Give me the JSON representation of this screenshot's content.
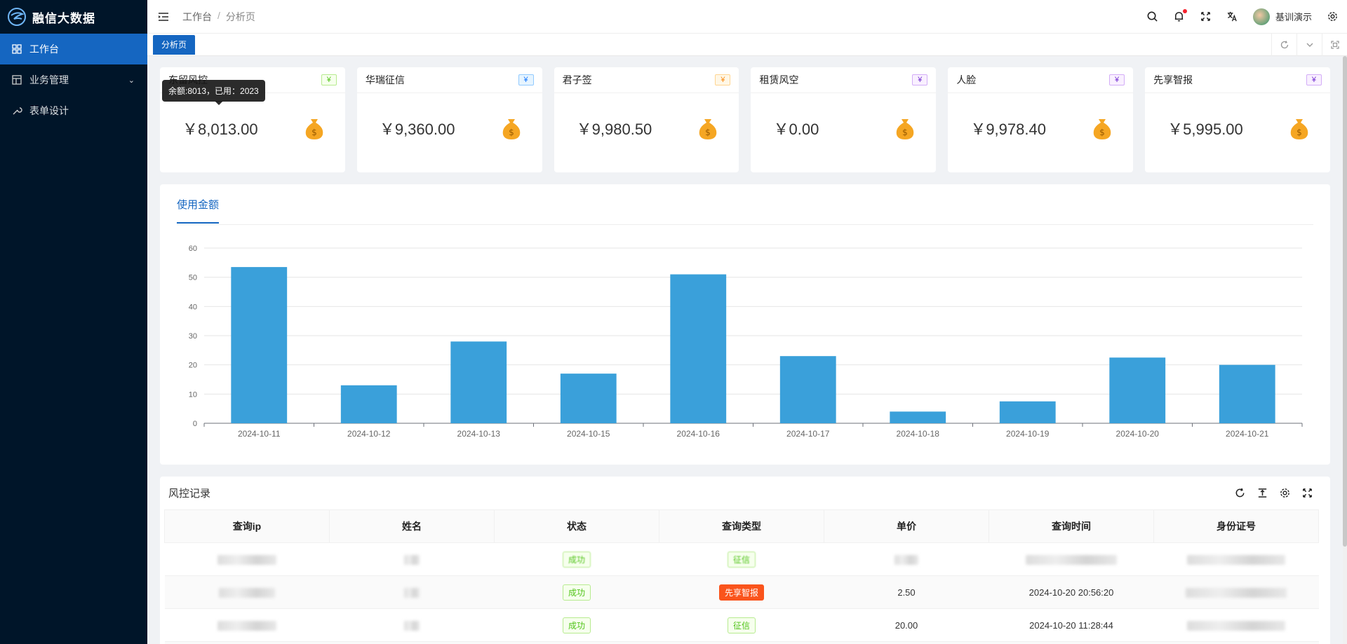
{
  "app": {
    "title": "融信大数据"
  },
  "sidebar": {
    "items": [
      {
        "label": "工作台",
        "icon": "dashboard-icon",
        "active": true
      },
      {
        "label": "业务管理",
        "icon": "table-icon",
        "active": false
      },
      {
        "label": "表单设计",
        "icon": "wrench-icon",
        "active": false
      }
    ]
  },
  "header": {
    "breadcrumb": [
      "工作台",
      "分析页"
    ],
    "user_name": "基训演示"
  },
  "tabs": [
    {
      "label": "分析页"
    }
  ],
  "cards": [
    {
      "title": "东留风控",
      "tag": "¥",
      "tag_color": "green",
      "value": "￥8,013.00"
    },
    {
      "title": "华瑞征信",
      "tag": "¥",
      "tag_color": "blue",
      "value": "￥9,360.00"
    },
    {
      "title": "君子签",
      "tag": "¥",
      "tag_color": "orange",
      "value": "￥9,980.50"
    },
    {
      "title": "租赁风空",
      "tag": "¥",
      "tag_color": "purple",
      "value": "￥0.00"
    },
    {
      "title": "人脸",
      "tag": "¥",
      "tag_color": "purple",
      "value": "￥9,978.40"
    },
    {
      "title": "先享智报",
      "tag": "¥",
      "tag_color": "purple",
      "value": "￥5,995.00"
    }
  ],
  "tooltip": {
    "text": "余额:8013，已用：2023"
  },
  "chart_tab": "使用金额",
  "chart_data": {
    "type": "bar",
    "categories": [
      "2024-10-11",
      "2024-10-12",
      "2024-10-13",
      "2024-10-15",
      "2024-10-16",
      "2024-10-17",
      "2024-10-18",
      "2024-10-19",
      "2024-10-20",
      "2024-10-21"
    ],
    "values": [
      53.5,
      13,
      28,
      17,
      51,
      23,
      4,
      7.5,
      22.5,
      20
    ],
    "yticks": [
      0,
      10,
      20,
      30,
      40,
      50,
      60
    ],
    "ylim": [
      0,
      60
    ],
    "color": "#3aa0da",
    "grid": true
  },
  "table": {
    "title": "风控记录",
    "columns": [
      "查询ip",
      "姓名",
      "状态",
      "查询类型",
      "单价",
      "查询时间",
      "身份证号"
    ],
    "rows": [
      {
        "status": "成功",
        "type": "征信",
        "type_style": "zx",
        "price": "",
        "time": "",
        "blurred": true
      },
      {
        "status": "成功",
        "type": "先享智报",
        "type_style": "orange",
        "price": "2.50",
        "time": "2024-10-20 20:56:20",
        "blurred": false
      },
      {
        "status": "成功",
        "type": "征信",
        "type_style": "zx",
        "price": "20.00",
        "time": "2024-10-20 11:28:44",
        "blurred": false
      }
    ]
  }
}
